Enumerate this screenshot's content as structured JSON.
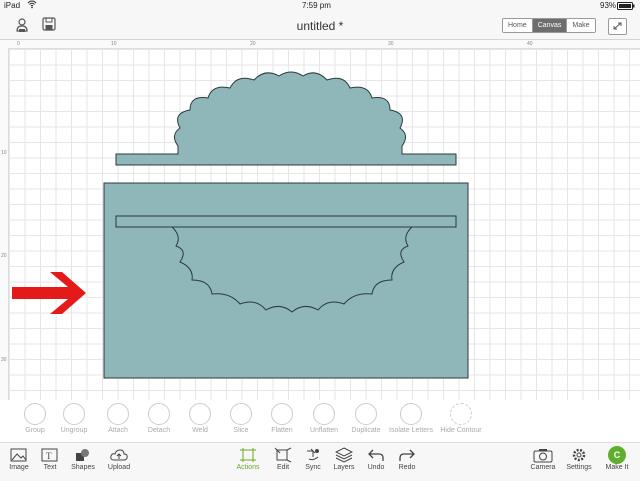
{
  "status": {
    "device": "iPad",
    "time": "7:59 pm",
    "battery": "93%"
  },
  "header": {
    "title": "untitled *",
    "tabs": [
      "Home",
      "Canvas",
      "Make"
    ],
    "active_tab": "Canvas"
  },
  "rulers": {
    "top": [
      "0",
      "10",
      "20",
      "30",
      "40"
    ],
    "left": [
      "10",
      "20",
      "30"
    ]
  },
  "colors": {
    "shape_fill": "#8fb6b9",
    "arrow": "#e41a1a",
    "accent_green": "#6aa82a"
  },
  "actions": [
    "Group",
    "Ungroup",
    "Attach",
    "Detach",
    "Weld",
    "Slice",
    "Flatten",
    "Unflatten",
    "Duplicate",
    "Isolate Letters",
    "Hide Contour"
  ],
  "toolbar_left": [
    "Image",
    "Text",
    "Shapes",
    "Upload"
  ],
  "toolbar_center": [
    "Actions",
    "Edit",
    "Sync",
    "Layers",
    "Undo",
    "Redo"
  ],
  "toolbar_right": [
    "Camera",
    "Settings",
    "Make It"
  ],
  "make_it_letter": "C"
}
